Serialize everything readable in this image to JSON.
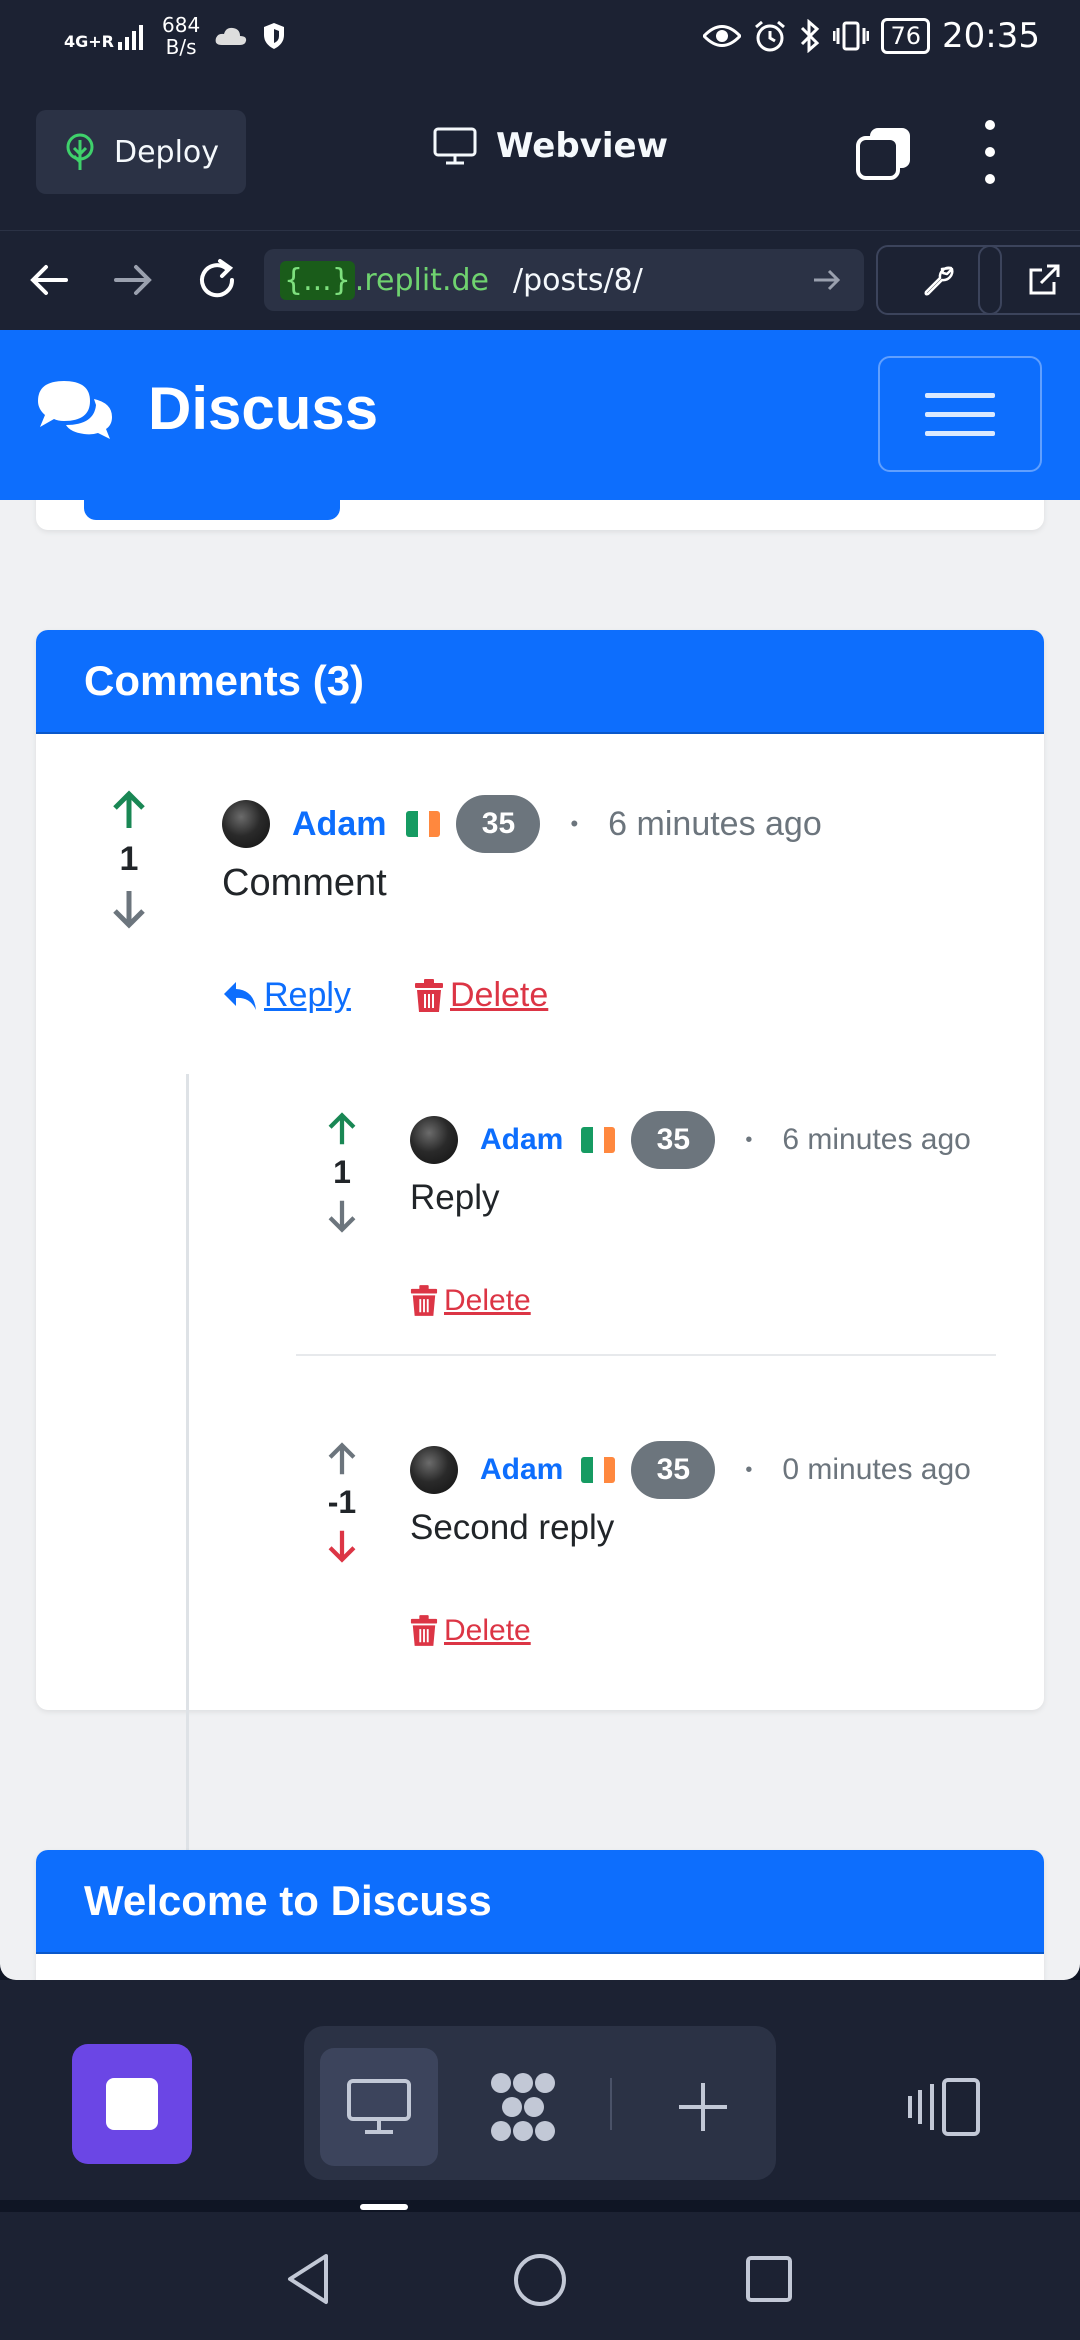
{
  "status_bar": {
    "network": "4G+R",
    "speed_value": "684",
    "speed_unit": "B/s",
    "battery": "76",
    "time": "20:35"
  },
  "replit": {
    "deploy_label": "Deploy",
    "view_title": "Webview",
    "url_dynamic": "{...}",
    "url_host": ".replit.de",
    "url_path": "/posts/8/"
  },
  "site": {
    "brand": "Discuss"
  },
  "comments_card": {
    "header": "Comments (3)",
    "comments": [
      {
        "score": "1",
        "author": "Adam",
        "karma": "35",
        "time": "6 minutes ago",
        "text": "Comment",
        "reply_label": " Reply ",
        "delete_label": " Delete",
        "vote_state": "up"
      }
    ],
    "replies": [
      {
        "score": "1",
        "author": "Adam",
        "karma": "35",
        "time": "6 minutes ago",
        "text": "Reply",
        "delete_label": " Delete",
        "vote_state": "up"
      },
      {
        "score": "-1",
        "author": "Adam",
        "karma": "35",
        "time": "0 minutes ago",
        "text": "Second reply",
        "delete_label": " Delete",
        "vote_state": "down"
      }
    ]
  },
  "welcome_card": {
    "header": "Welcome to Discuss"
  },
  "colors": {
    "primary": "#0d6efd",
    "upvote_active": "#198754",
    "downvote_active": "#dc3545",
    "inactive_arrow": "#6c757d",
    "stop_button": "#6b46e5"
  },
  "icons": {
    "deploy": "deploy-tree-icon",
    "webview": "monitor-icon",
    "back": "arrow-left-icon",
    "forward": "arrow-right-icon",
    "reload": "reload-icon",
    "devtools": "wrench-icon",
    "open_external": "external-link-icon",
    "brand": "chat-bubbles-icon",
    "menu": "hamburger-icon"
  }
}
